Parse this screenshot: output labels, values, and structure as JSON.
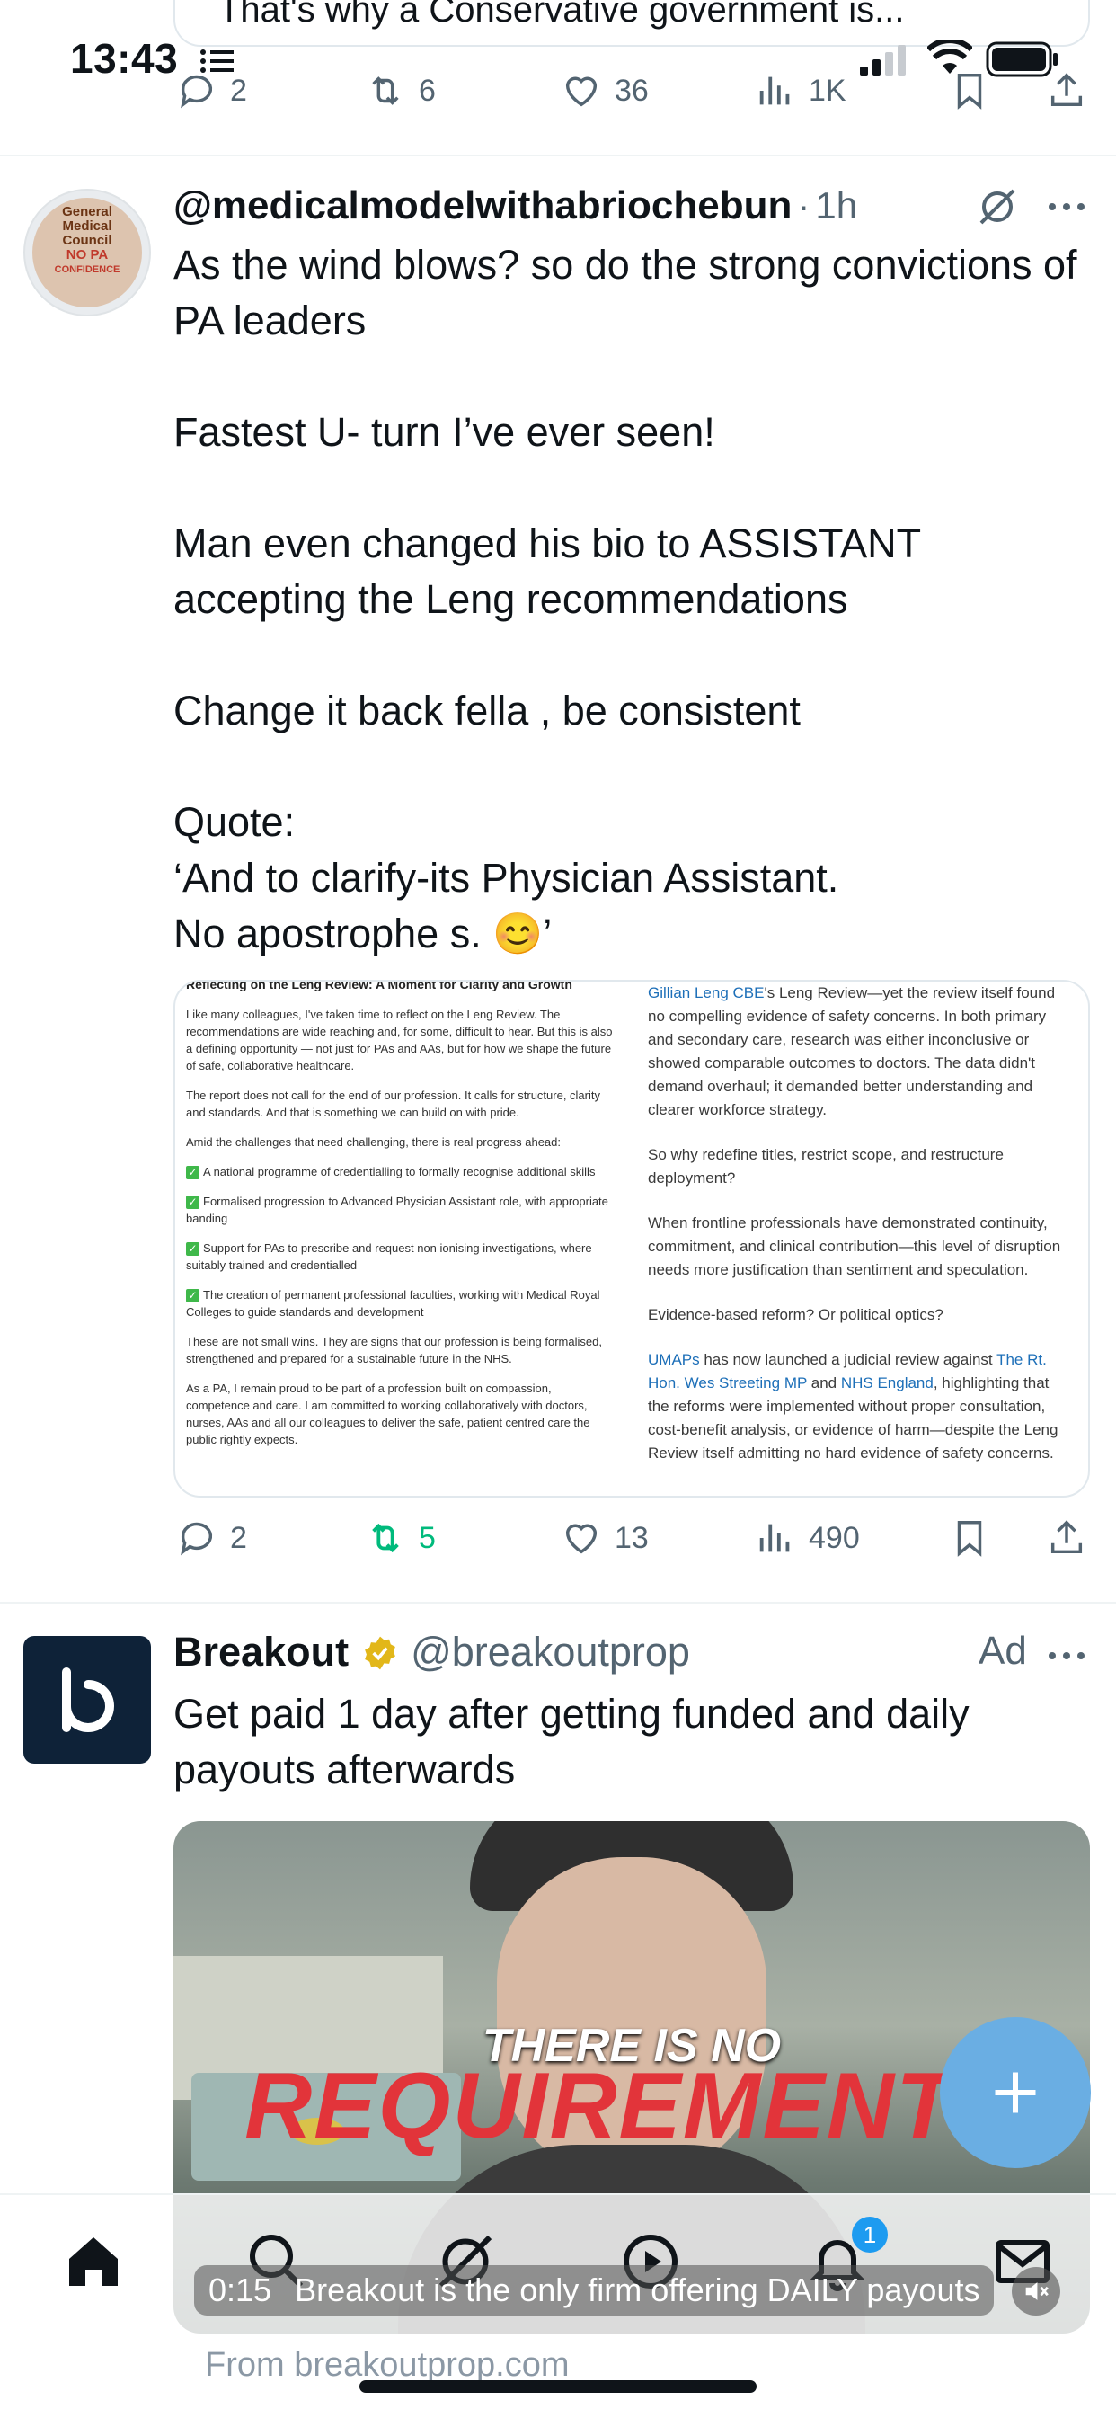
{
  "status_bar": {
    "time": "13:43"
  },
  "previous_tweet": {
    "quote_text_fragment": "That's why a Conservative government is...",
    "actions": {
      "replies": "2",
      "retweets": "6",
      "likes": "36",
      "views": "1K"
    }
  },
  "tweet": {
    "handle": "@medicalmodelwithabriochebun",
    "separator": "·",
    "time": "1h",
    "avatar_text": [
      "General",
      "Medical",
      "Council",
      "NO",
      "PA",
      "CONFIDENCE"
    ],
    "text": "As the wind blows? so do the strong convictions of PA leaders\n\nFastest U- turn I’ve ever seen!\n\nMan even changed his bio to ASSISTANT accepting the Leng recommendations\n\nChange it back fella , be consistent\n\nQuote:\n‘And to clarify-its Physician Assistant.\nNo apostrophe s. 😊’",
    "image_left": {
      "heading": "Reflecting on the Leng Review: A Moment for Clarity and Growth",
      "p1": "Like many colleagues, I've taken time to reflect on the Leng Review. The recommendations are wide reaching and, for some, difficult to hear. But this is also a defining opportunity — not just for PAs and AAs, but for how we shape the future of safe, collaborative healthcare.",
      "p2": "The report does not call for the end of our profession. It calls for structure, clarity and standards. And that is something we can build on with pride.",
      "p3": "Amid the challenges that need challenging, there is real progress ahead:",
      "b1": "A national programme of credentialling to formally recognise additional skills",
      "b2": "Formalised progression to Advanced Physician Assistant role, with appropriate banding",
      "b3": "Support for PAs to prescribe and request non ionising investigations, where suitably trained and credentialled",
      "b4": "The creation of permanent professional faculties, working with Medical Royal Colleges to guide standards and development",
      "p4": "These are not small wins. They are signs that our profession is being formalised, strengthened and prepared for a sustainable future in the NHS.",
      "p5": "As a PA, I remain proud to be part of a profession built on compassion, competence and care. I am committed to working collaboratively with doctors, nurses, AAs and all our colleagues to deliver the safe, patient centred care the public rightly expects."
    },
    "image_right": {
      "p1_link": "Gillian Leng CBE",
      "p1": "'s Leng Review—yet the review itself found no compelling evidence of safety concerns. In both primary and secondary care, research was either inconclusive or showed comparable outcomes to doctors. The data didn't demand overhaul; it demanded better understanding and clearer workforce strategy.",
      "p2": "So why redefine titles, restrict scope, and restructure deployment?",
      "p3": "When frontline professionals have demonstrated continuity, commitment, and clinical contribution—this level of disruption needs more justification than sentiment and speculation.",
      "p4": "Evidence-based reform? Or political optics?",
      "p5_link1": "UMAPs",
      "p5_a": " has now launched a judicial review against ",
      "p5_link2": "The Rt. Hon. Wes Streeting MP",
      "p5_b": " and ",
      "p5_link3": "NHS England",
      "p5_c": ", highlighting that the reforms were implemented without proper consultation, cost-benefit analysis, or evidence of harm—despite the Leng Review itself admitting no hard evidence of safety concerns."
    },
    "actions": {
      "replies": "2",
      "retweets": "5",
      "likes": "13",
      "views": "490"
    }
  },
  "ad": {
    "name": "Breakout",
    "handle": "@breakoutprop",
    "label": "Ad",
    "text": "Get paid 1 day after getting funded and daily payouts afterwards",
    "video_caption_top": "THERE IS NO",
    "video_caption_big": "REQUIREMENTS",
    "video_time": "0:15",
    "video_subtitle": "Breakout is the only firm offering DAILY payouts",
    "from": "From breakoutprop.com"
  },
  "tabbar": {
    "notifications_badge": "1"
  },
  "colors": {
    "accent": "#1d9bf0",
    "retweet_green": "#00ba7c",
    "fab": "#6aaee3",
    "text": "#0f1419",
    "muted": "#536471"
  }
}
